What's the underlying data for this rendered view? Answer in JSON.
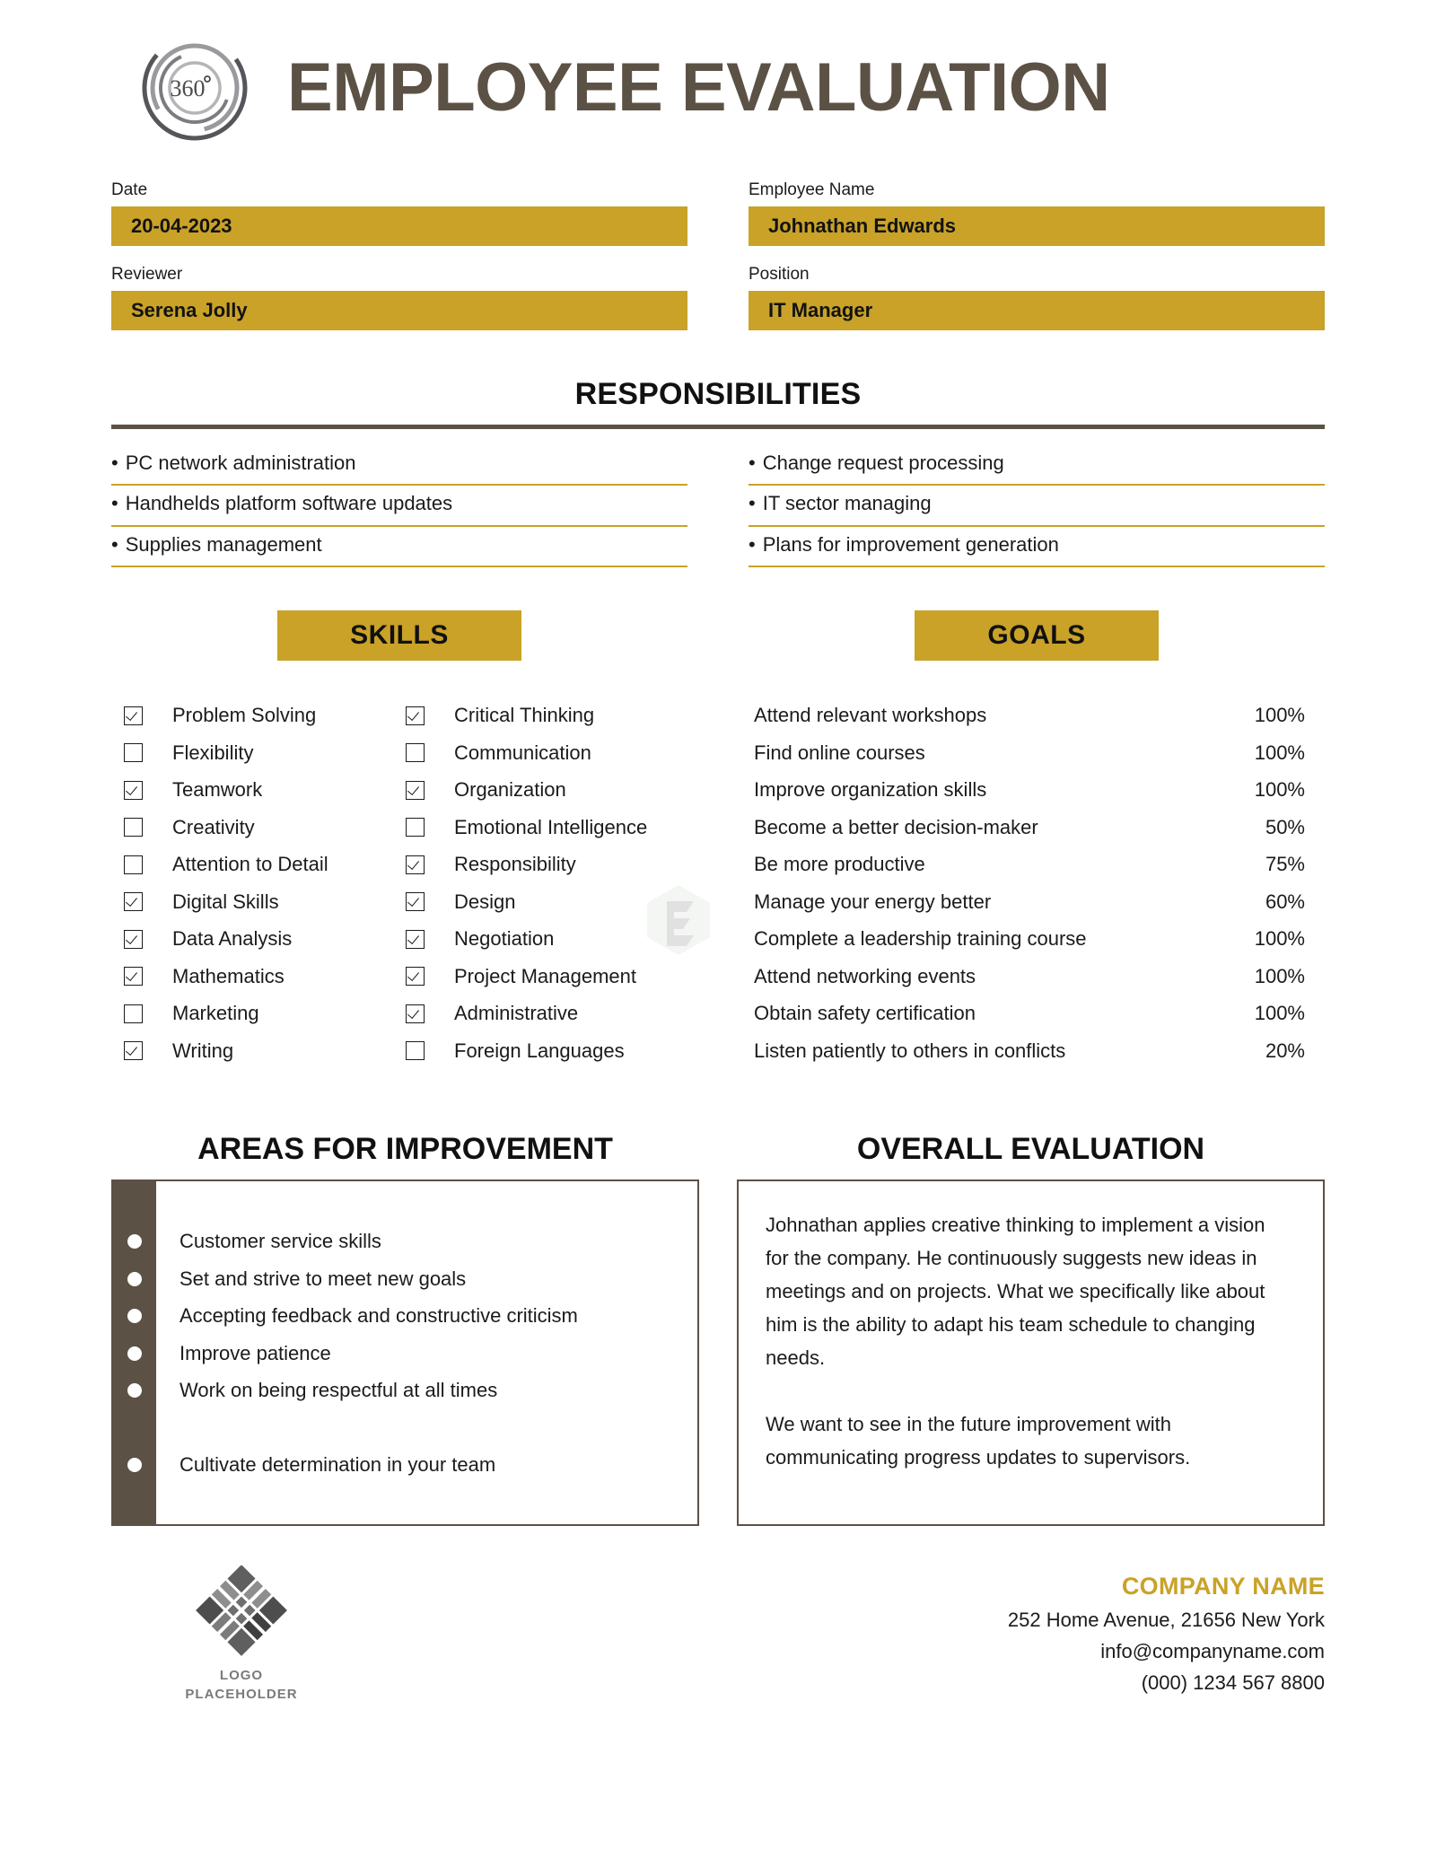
{
  "header": {
    "title": "EMPLOYEE EVALUATION",
    "logo_badge_text": "360",
    "logo_degree_symbol": "°"
  },
  "fields": {
    "date": {
      "label": "Date",
      "value": "20-04-2023"
    },
    "employee_name": {
      "label": "Employee Name",
      "value": "Johnathan Edwards"
    },
    "reviewer": {
      "label": "Reviewer",
      "value": "Serena Jolly"
    },
    "position": {
      "label": "Position",
      "value": "IT Manager"
    }
  },
  "responsibilities": {
    "title": "RESPONSIBILITIES",
    "bullet": "•",
    "left": [
      "PC network administration",
      "Handhelds platform software updates",
      "Supplies management"
    ],
    "right": [
      "Change request processing",
      "IT sector managing",
      "Plans for improvement generation"
    ]
  },
  "skills": {
    "title": "SKILLS",
    "left": [
      {
        "label": "Problem Solving",
        "checked": true
      },
      {
        "label": "Flexibility",
        "checked": false
      },
      {
        "label": "Teamwork",
        "checked": true
      },
      {
        "label": "Creativity",
        "checked": false
      },
      {
        "label": "Attention to Detail",
        "checked": false
      },
      {
        "label": "Digital Skills",
        "checked": true
      },
      {
        "label": "Data Analysis",
        "checked": true
      },
      {
        "label": "Mathematics",
        "checked": true
      },
      {
        "label": "Marketing",
        "checked": false
      },
      {
        "label": "Writing",
        "checked": true
      }
    ],
    "right": [
      {
        "label": "Critical Thinking",
        "checked": true
      },
      {
        "label": "Communication",
        "checked": false
      },
      {
        "label": "Organization",
        "checked": true
      },
      {
        "label": "Emotional Intelligence",
        "checked": false
      },
      {
        "label": "Responsibility",
        "checked": true
      },
      {
        "label": "Design",
        "checked": true
      },
      {
        "label": "Negotiation",
        "checked": true
      },
      {
        "label": "Project Management",
        "checked": true
      },
      {
        "label": "Administrative",
        "checked": true
      },
      {
        "label": "Foreign Languages",
        "checked": false
      }
    ]
  },
  "goals": {
    "title": "GOALS",
    "items": [
      {
        "label": "Attend relevant workshops",
        "progress": "100%"
      },
      {
        "label": "Find online courses",
        "progress": "100%"
      },
      {
        "label": "Improve organization skills",
        "progress": "100%"
      },
      {
        "label": "Become a better decision-maker",
        "progress": "50%"
      },
      {
        "label": "Be more productive",
        "progress": "75%"
      },
      {
        "label": "Manage your energy better",
        "progress": "60%"
      },
      {
        "label": "Complete a leadership training course",
        "progress": "100%"
      },
      {
        "label": "Attend networking events",
        "progress": "100%"
      },
      {
        "label": "Obtain safety certification",
        "progress": "100%"
      },
      {
        "label": "Listen patiently to others in conflicts",
        "progress": "20%"
      }
    ]
  },
  "areas_for_improvement": {
    "title": "AREAS FOR IMPROVEMENT",
    "items": [
      "Customer service skills",
      "Set and strive to meet new goals",
      "Accepting feedback and constructive criticism",
      "Improve patience",
      "Work on being respectful at all times",
      "",
      "Cultivate determination in your team"
    ]
  },
  "overall_evaluation": {
    "title": "OVERALL EVALUATION",
    "paragraphs": [
      "Johnathan applies creative thinking to implement a vision for the company. He continuously suggests new ideas in meetings and on projects. What we specifically like about him is the ability to adapt his team schedule to changing needs.",
      "We want to see in the future improvement with communicating progress updates to supervisors."
    ]
  },
  "footer": {
    "logo_caption_line1": "LOGO",
    "logo_caption_line2": "PLACEHOLDER",
    "company_name": "COMPANY NAME",
    "address": "252 Home Avenue, 21656 New York",
    "email": "info@companyname.com",
    "phone": "(000) 1234 567 8800"
  },
  "colors": {
    "gold": "#c9a227",
    "brown": "#5b5145",
    "text": "#1b1b1b"
  }
}
